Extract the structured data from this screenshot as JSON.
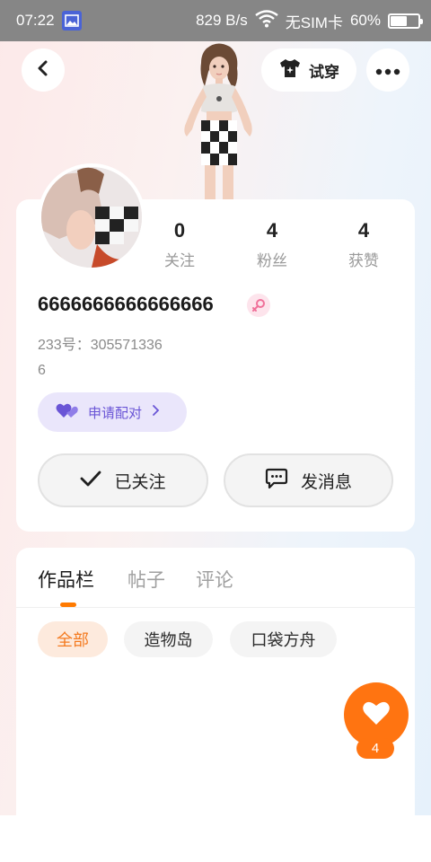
{
  "status_bar": {
    "time": "07:22",
    "network_speed": "829 B/s",
    "sim": "无SIM卡",
    "battery": "60%",
    "battery_level": 0.6
  },
  "header": {
    "try_on_label": "试穿"
  },
  "profile": {
    "stats": [
      {
        "value": "0",
        "label": "关注"
      },
      {
        "value": "4",
        "label": "粉丝"
      },
      {
        "value": "4",
        "label": "获赞"
      }
    ],
    "username": "6666666666666666",
    "uid_label": "233号：",
    "uid_value": "305571336",
    "bio": "6",
    "pair_label": "申请配对",
    "follow_label": "已关注",
    "message_label": "发消息"
  },
  "content": {
    "tabs": [
      "作品栏",
      "帖子",
      "评论"
    ],
    "active_tab": 0,
    "filters": [
      "全部",
      "造物岛",
      "口袋方舟"
    ],
    "active_filter": 0
  },
  "like_fab": {
    "count": "4"
  },
  "colors": {
    "accent": "#ff7411",
    "pair_bg": "#eae6fb",
    "pair_text": "#6a55d6"
  }
}
